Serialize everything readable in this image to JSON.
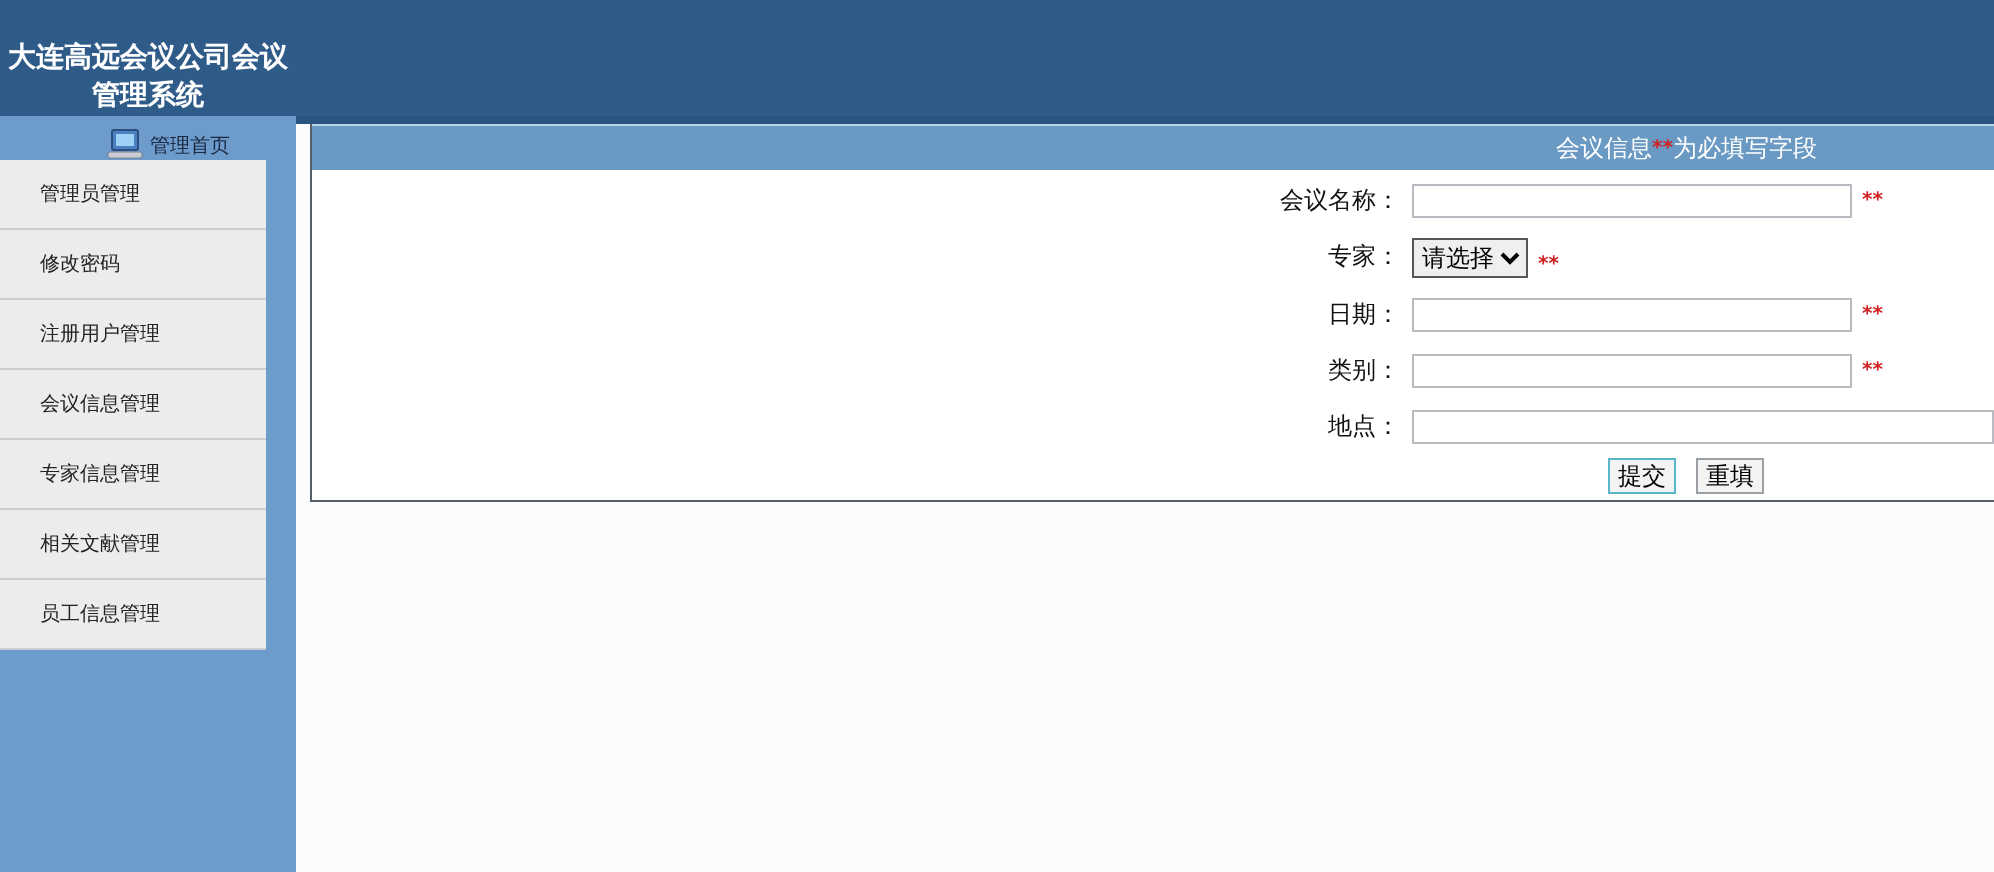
{
  "header": {
    "title": "大连高远会议公司会议管理系统"
  },
  "sidebar": {
    "home": "管理首页",
    "items": [
      {
        "label": "管理员管理"
      },
      {
        "label": "修改密码"
      },
      {
        "label": "注册用户管理"
      },
      {
        "label": "会议信息管理"
      },
      {
        "label": "专家信息管理"
      },
      {
        "label": "相关文献管理"
      },
      {
        "label": "员工信息管理"
      }
    ]
  },
  "form": {
    "heading": "会议信息",
    "heading_mark": "**",
    "heading_note": "为必填写字段",
    "fields": [
      {
        "label": "会议名称：",
        "kind": "text",
        "required_mark": "**"
      },
      {
        "label": "专家：",
        "kind": "select",
        "value": "请选择",
        "required_mark": "**"
      },
      {
        "label": "日期：",
        "kind": "text",
        "required_mark": "**"
      },
      {
        "label": "类别：",
        "kind": "text",
        "required_mark": "**"
      },
      {
        "label": "地点：",
        "kind": "wide"
      }
    ],
    "buttons": [
      {
        "label": "提交",
        "kind": "submit"
      },
      {
        "label": "重填",
        "kind": "reset"
      }
    ]
  }
}
